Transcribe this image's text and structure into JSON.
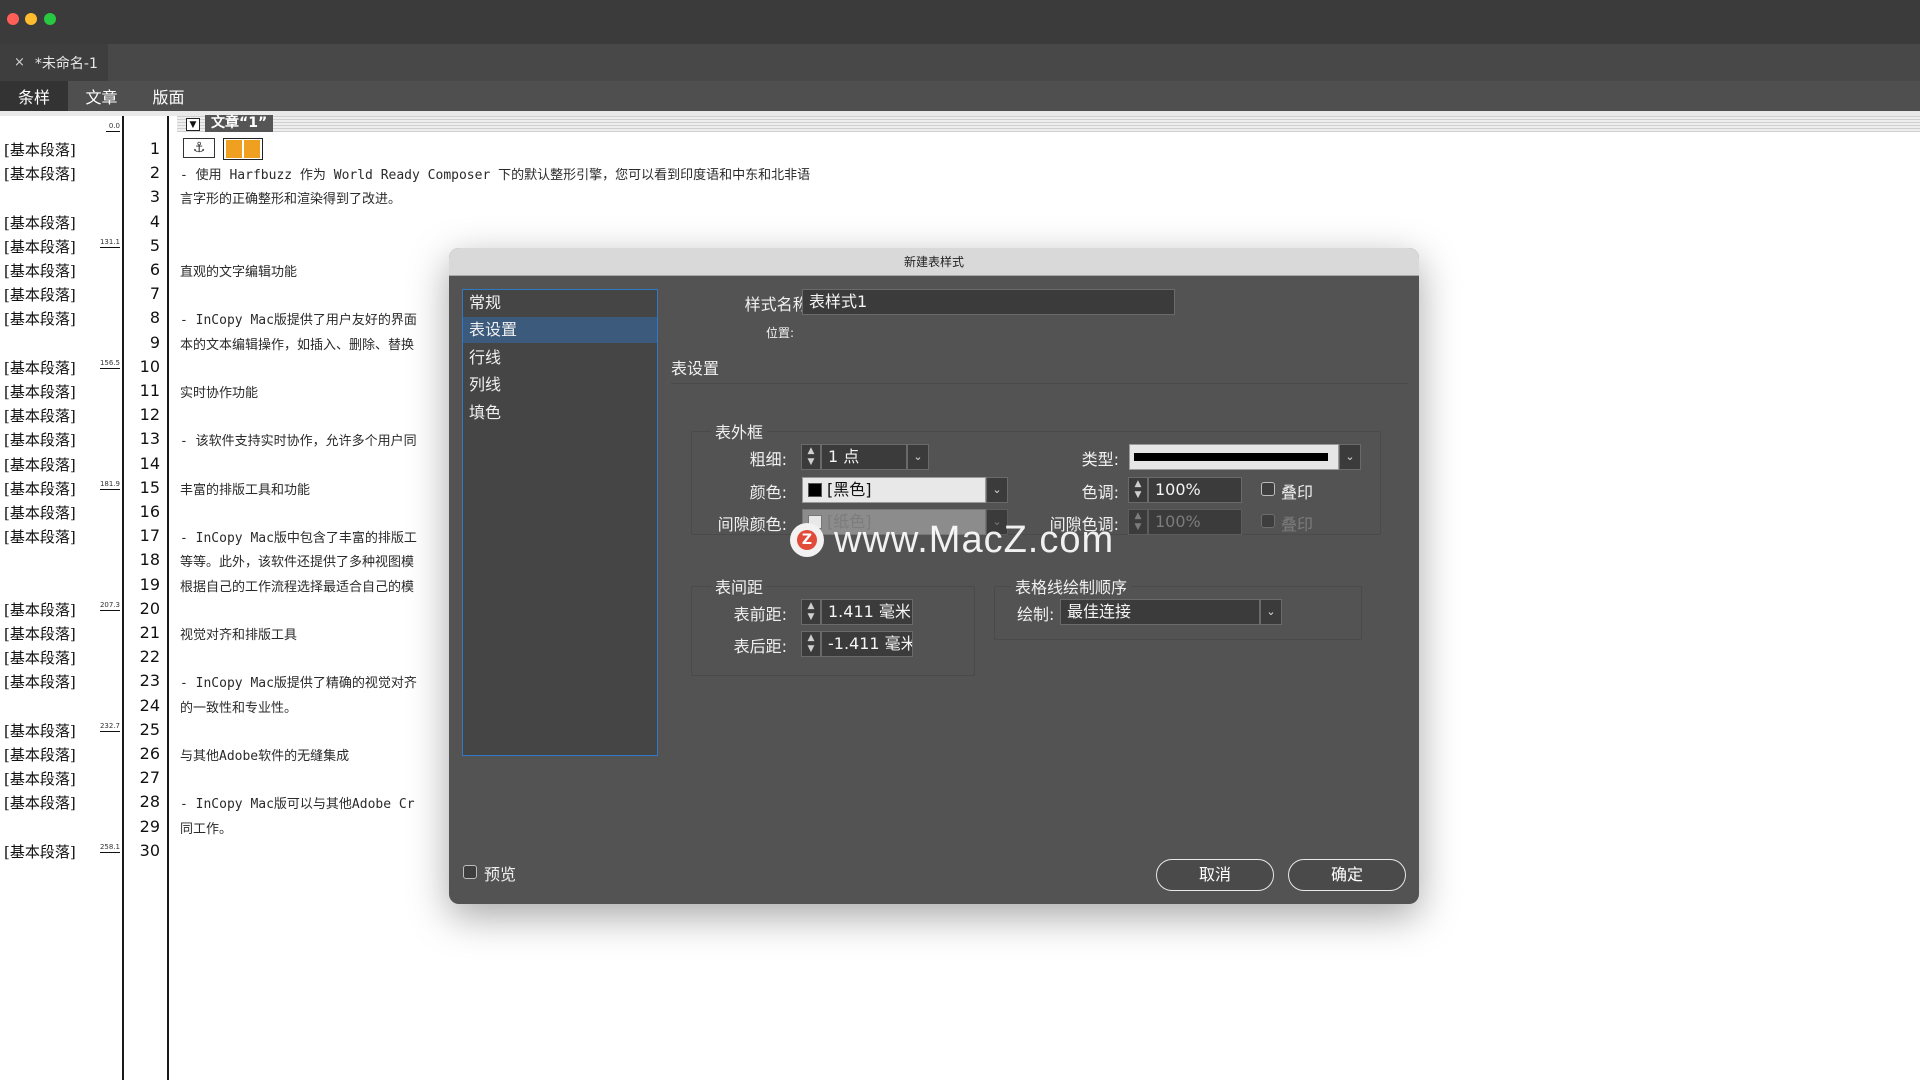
{
  "window": {
    "document_tab": "*未命名-1",
    "close_glyph": "×"
  },
  "traffic_lights": {
    "close": "#ff5f57",
    "minimize": "#febc2e",
    "zoom": "#28c840"
  },
  "view_tabs": [
    "条样",
    "文章",
    "版面"
  ],
  "story": {
    "title": "文章“1”",
    "toggle_glyph": "▼",
    "anchor_glyph": "⚓"
  },
  "gutter": {
    "style_name": "[基本段落]",
    "top_depth": "0.0",
    "rows": [
      {
        "n": "1",
        "s": true
      },
      {
        "n": "2",
        "s": true
      },
      {
        "n": "3",
        "s": false
      },
      {
        "n": "4",
        "s": true
      },
      {
        "n": "5",
        "s": true,
        "d": "131.1"
      },
      {
        "n": "6",
        "s": true
      },
      {
        "n": "7",
        "s": true
      },
      {
        "n": "8",
        "s": true
      },
      {
        "n": "9",
        "s": false
      },
      {
        "n": "10",
        "s": true,
        "d": "156.5"
      },
      {
        "n": "11",
        "s": true
      },
      {
        "n": "12",
        "s": true
      },
      {
        "n": "13",
        "s": true
      },
      {
        "n": "14",
        "s": true
      },
      {
        "n": "15",
        "s": true,
        "d": "181.9"
      },
      {
        "n": "16",
        "s": true
      },
      {
        "n": "17",
        "s": true
      },
      {
        "n": "18",
        "s": false
      },
      {
        "n": "19",
        "s": false
      },
      {
        "n": "20",
        "s": true,
        "d": "207.3"
      },
      {
        "n": "21",
        "s": true
      },
      {
        "n": "22",
        "s": true
      },
      {
        "n": "23",
        "s": true
      },
      {
        "n": "24",
        "s": false
      },
      {
        "n": "25",
        "s": true,
        "d": "232.7"
      },
      {
        "n": "26",
        "s": true
      },
      {
        "n": "27",
        "s": true
      },
      {
        "n": "28",
        "s": true
      },
      {
        "n": "29",
        "s": false
      },
      {
        "n": "30",
        "s": true,
        "d": "258.1"
      }
    ]
  },
  "text_lines": [
    {
      "line": 2,
      "text": "- 使用 Harfbuzz 作为 World Ready Composer 下的默认整形引擎，您可以看到印度语和中东和北非语"
    },
    {
      "line": 3,
      "text": "言字形的正确整形和渲染得到了改进。"
    },
    {
      "line": 6,
      "text": "直观的文字编辑功能"
    },
    {
      "line": 8,
      "text": "- InCopy Mac版提供了用户友好的界面"
    },
    {
      "line": 9,
      "text": "本的文本编辑操作，如插入、删除、替换"
    },
    {
      "line": 11,
      "text": "实时协作功能"
    },
    {
      "line": 13,
      "text": "- 该软件支持实时协作，允许多个用户同"
    },
    {
      "line": 15,
      "text": "丰富的排版工具和功能"
    },
    {
      "line": 17,
      "text": "- InCopy Mac版中包含了丰富的排版工"
    },
    {
      "line": 18,
      "text": "等等。此外，该软件还提供了多种视图模"
    },
    {
      "line": 19,
      "text": "根据自己的工作流程选择最适合自己的模"
    },
    {
      "line": 21,
      "text": "视觉对齐和排版工具"
    },
    {
      "line": 23,
      "text": "- InCopy Mac版提供了精确的视觉对齐"
    },
    {
      "line": 24,
      "text": "的一致性和专业性。"
    },
    {
      "line": 26,
      "text": "与其他Adobe软件的无缝集成"
    },
    {
      "line": 28,
      "text": "- InCopy Mac版可以与其他Adobe Cr"
    },
    {
      "line": 29,
      "text": "同工作。"
    }
  ],
  "dialog": {
    "title": "新建表样式",
    "categories": [
      "常规",
      "表设置",
      "行线",
      "列线",
      "填色"
    ],
    "selected_category": "表设置",
    "style_name_label": "样式名称:",
    "style_name_value": "表样式1",
    "location_label": "位置:",
    "section_title": "表设置",
    "border": {
      "title": "表外框",
      "weight_label": "粗细:",
      "weight_value": "1 点",
      "type_label": "类型:",
      "color_label": "颜色:",
      "color_value": "[黑色]",
      "tint_label": "色调:",
      "tint_value": "100%",
      "overprint_label": "叠印",
      "gap_color_label": "间隙颜色:",
      "gap_color_value": "[纸色]",
      "gap_tint_label": "间隙色调:",
      "gap_tint_value": "100%",
      "gap_overprint_label": "叠印"
    },
    "spacing": {
      "title": "表间距",
      "before_label": "表前距:",
      "before_value": "1.411 毫米",
      "after_label": "表后距:",
      "after_value": "-1.411 毫米"
    },
    "draw_order": {
      "title": "表格线绘制顺序",
      "draw_label": "绘制:",
      "draw_value": "最佳连接"
    },
    "preview_label": "预览",
    "cancel_label": "取消",
    "ok_label": "确定"
  },
  "watermark": {
    "logo_letter": "Z",
    "text": "www.MacZ.com"
  }
}
